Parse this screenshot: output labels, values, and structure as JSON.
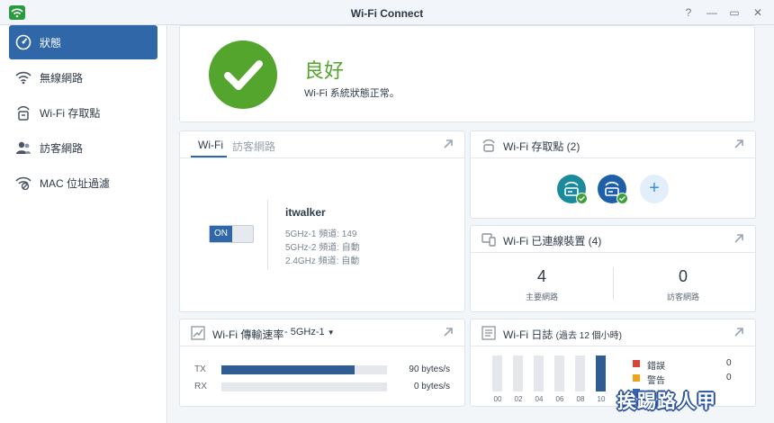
{
  "window": {
    "title": "Wi-Fi Connect",
    "controls": {
      "help": "?",
      "minimize": "—",
      "maximize": "▭",
      "close": "✕"
    }
  },
  "sidebar": {
    "items": [
      {
        "label": "狀態",
        "icon": "status-gauge-icon",
        "active": true
      },
      {
        "label": "無線網路",
        "icon": "wifi-icon",
        "active": false
      },
      {
        "label": "Wi-Fi 存取點",
        "icon": "access-point-icon",
        "active": false
      },
      {
        "label": "訪客網路",
        "icon": "guest-users-icon",
        "active": false
      },
      {
        "label": "MAC 位址過濾",
        "icon": "mac-filter-icon",
        "active": false
      }
    ]
  },
  "status": {
    "title": "良好",
    "subtitle": "Wi-Fi 系統狀態正常。",
    "color": "#53a52d"
  },
  "wifi_panel": {
    "tabs": [
      "Wi-Fi",
      "訪客網路"
    ],
    "active_tab": "Wi-Fi",
    "toggle_label": "ON",
    "ssid": "itwalker",
    "bands": [
      "5GHz-1 頻道: 149",
      "5GHz-2 頻道: 自動",
      "2.4GHz 頻道: 自動"
    ]
  },
  "access_points": {
    "title": "Wi-Fi 存取點",
    "count": "(2)",
    "devices": [
      {
        "icon": "router-icon",
        "color": "#1a8a9c",
        "status": "ok"
      },
      {
        "icon": "router-icon",
        "color": "#1f5fa8",
        "status": "ok"
      }
    ],
    "add_label": "+"
  },
  "connected_devices": {
    "title": "Wi-Fi 已連線裝置",
    "count": "(4)",
    "main_count": "4",
    "main_label": "主要網路",
    "guest_count": "0",
    "guest_label": "訪客網路"
  },
  "speed": {
    "title": "Wi-Fi 傳輸速率",
    "band_select": "- 5GHz-1",
    "tx_label": "TX",
    "tx_value": "90 bytes/s",
    "tx_fill": 0.9,
    "rx_label": "RX",
    "rx_value": "0 bytes/s",
    "rx_fill": 0.0
  },
  "log": {
    "title": "Wi-Fi 日誌",
    "subtitle": "(過去 12 個小時)",
    "ticks": [
      "00",
      "02",
      "04",
      "06",
      "08",
      "10"
    ],
    "bar_levels": [
      0,
      0,
      0,
      0,
      0,
      1
    ],
    "legend": [
      {
        "label": "錯誤",
        "count": "0",
        "color": "#d9433a"
      },
      {
        "label": "警告",
        "count": "0",
        "color": "#f0a21c"
      },
      {
        "label": "資訊",
        "count": "",
        "color": "#2f67a8"
      }
    ]
  },
  "watermark": "挨踢路人甲"
}
